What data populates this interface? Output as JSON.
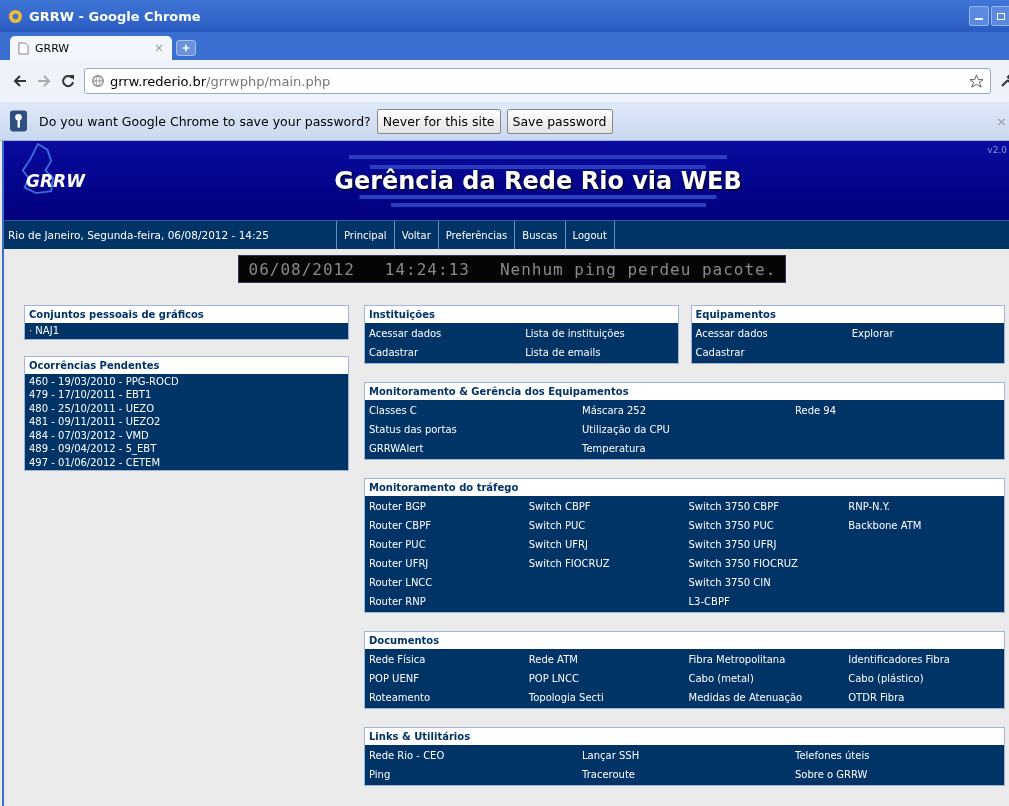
{
  "window": {
    "title": "GRRW - Google Chrome"
  },
  "tabs": [
    {
      "label": "GRRW",
      "selected": true,
      "close": "×"
    }
  ],
  "address": {
    "host": "grrw.rederio.br",
    "path": "/grrwphp/main.php"
  },
  "infobar": {
    "message": "Do you want Google Chrome to save your password?",
    "buttons": [
      "Never for this site",
      "Save password"
    ],
    "close": "×"
  },
  "header": {
    "logo": "GRRW",
    "title": "Gerência da Rede Rio via WEB",
    "version": "v2.0"
  },
  "navbar": {
    "date": "Rio de Janeiro, Segunda-feira, 06/08/2012 - 14:25",
    "links": [
      "Principal",
      "Voltar",
      "Preferências",
      "Buscas",
      "Logout"
    ]
  },
  "ticker": {
    "date": "06/08/2012",
    "time": "14:24:13",
    "message": "Nenhum ping perdeu pacote."
  },
  "left_panels": [
    {
      "title": "Conjuntos pessoais de gráficos",
      "items": [
        "· NAJ1"
      ]
    },
    {
      "title": "Ocorrências Pendentes",
      "items": [
        "460 - 19/03/2010 - PPG-ROCD",
        "479 - 17/10/2011 - EBT1",
        "480 - 25/10/2011 - UEZO",
        "481 - 09/11/2011 - UEZO2",
        "484 - 07/03/2012 - VMD",
        "489 - 09/04/2012 - 5_EBT",
        "497 - 01/06/2012 - CETEM"
      ]
    }
  ],
  "top_panels": [
    {
      "title": "Instituições",
      "columns": [
        [
          "Acessar dados",
          "Cadastrar"
        ],
        [
          "Lista de instituições",
          "Lista de emails"
        ]
      ]
    },
    {
      "title": "Equipamentos",
      "columns": [
        [
          "Acessar dados",
          "Cadastrar"
        ],
        [
          "Explorar"
        ]
      ]
    }
  ],
  "panels": [
    {
      "title": "Monitoramento & Gerência dos Equipamentos",
      "columns": [
        [
          "Classes C",
          "Status das portas",
          "GRRWAlert"
        ],
        [
          "Máscara 252",
          "Utilização da CPU",
          "Temperatura"
        ],
        [
          "Rede 94"
        ]
      ]
    },
    {
      "title": "Monitoramento do tráfego",
      "columns": [
        [
          "Router BGP",
          "Router CBPF",
          "Router PUC",
          "Router UFRJ",
          "Router LNCC",
          "Router RNP"
        ],
        [
          "Switch CBPF",
          "Switch PUC",
          "Switch UFRJ",
          "Switch FIOCRUZ"
        ],
        [
          "Switch 3750 CBPF",
          "Switch 3750 PUC",
          "Switch 3750 UFRJ",
          "Switch 3750 FIOCRUZ",
          "Switch 3750 CIN",
          "L3-CBPF"
        ],
        [
          "RNP-N.Y.",
          "Backbone ATM"
        ]
      ]
    },
    {
      "title": "Documentos",
      "columns": [
        [
          "Rede Física",
          "POP UENF",
          "Roteamento"
        ],
        [
          "Rede ATM",
          "POP LNCC",
          "Topologia Secti"
        ],
        [
          "Fibra Metropolitana",
          "Cabo (metal)",
          "Medidas de Atenuação"
        ],
        [
          "Identificadores Fibra",
          "Cabo (plástico)",
          "OTDR Fibra"
        ]
      ]
    },
    {
      "title": "Links & Utilitários",
      "columns": [
        [
          "Rede Rio - CEO",
          "Ping"
        ],
        [
          "Lançar SSH",
          "Traceroute"
        ],
        [
          "Telefones úteis",
          "Sobre o GRRW"
        ]
      ]
    }
  ]
}
